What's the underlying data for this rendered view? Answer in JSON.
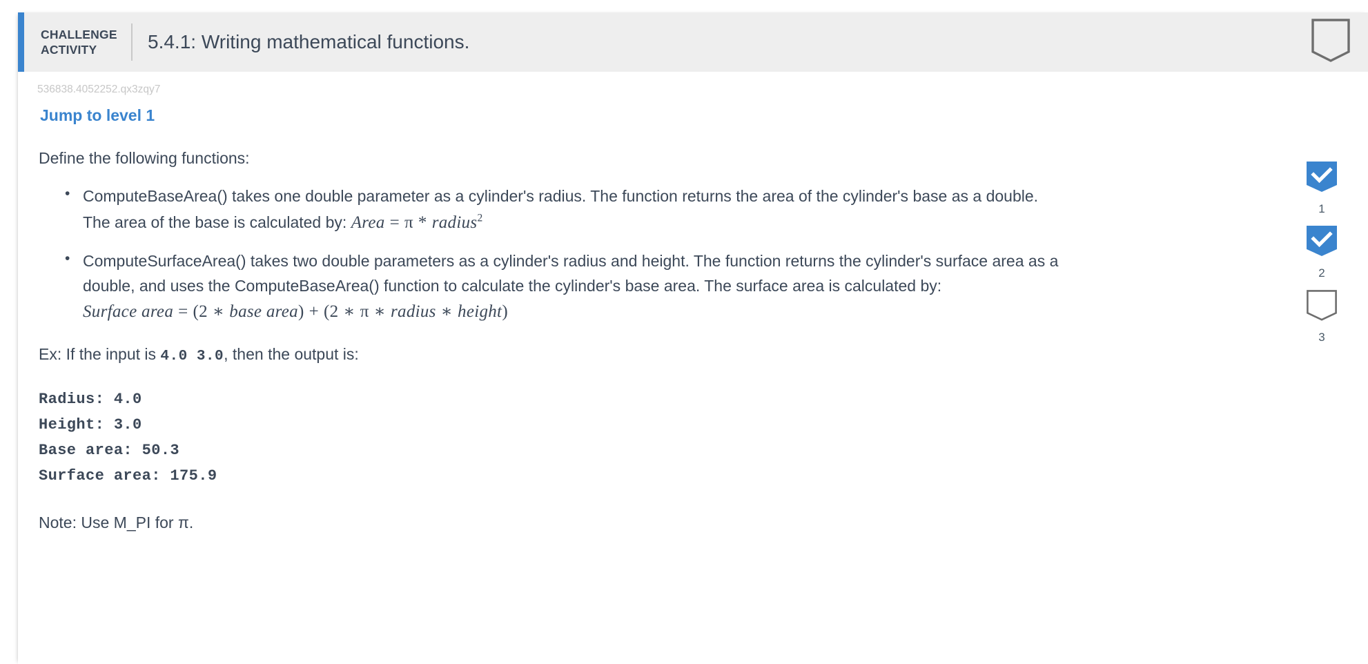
{
  "header": {
    "kicker_line1": "CHALLENGE",
    "kicker_line2": "ACTIVITY",
    "title": "5.4.1: Writing mathematical functions.",
    "banner_icon": "banner-outline-icon",
    "accent_color": "#3a84ce",
    "background_color": "#eeeeee"
  },
  "body": {
    "activity_id": "536838.4052252.qx3zqy7",
    "jump_link": "Jump to level 1",
    "intro": "Define the following functions:",
    "bullets": [
      {
        "text": "ComputeBaseArea() takes one double parameter as a cylinder's radius. The function returns the area of the cylinder's base as a double. The area of the base is calculated by: ",
        "formula": {
          "lhs": "Area",
          "eq": "=",
          "rhs_tokens": [
            "π",
            "*",
            "radius"
          ],
          "exponent": "2",
          "plain": "Area = π * radius^2"
        }
      },
      {
        "text": "ComputeSurfaceArea() takes two double parameters as a cylinder's radius and height. The function returns the cylinder's surface area as a double, and uses the ComputeBaseArea() function to calculate the cylinder's base area. The surface area is calculated by: ",
        "formula": {
          "lhs": "Surface area",
          "eq": "=",
          "plain": "Surface area = (2 * base area) + (2 * π * radius * height)"
        }
      }
    ],
    "example_prefix": "Ex: If the input is ",
    "example_input": "4.0  3.0",
    "example_suffix": ", then the output is:",
    "output_lines": [
      "Radius: 4.0",
      "Height: 3.0",
      "Base area: 50.3",
      "Surface area: 175.9"
    ],
    "note": "Note: Use M_PI for π."
  },
  "steps": [
    {
      "label": "1",
      "state": "complete",
      "icon": "banner-check-icon"
    },
    {
      "label": "2",
      "state": "complete",
      "icon": "banner-check-icon"
    },
    {
      "label": "3",
      "state": "incomplete",
      "icon": "banner-outline-icon"
    }
  ],
  "colors": {
    "accent": "#3a84ce",
    "text": "#3c4858",
    "muted": "#c7c7c7",
    "header_bg": "#eeeeee",
    "outline": "#6e6e6e"
  }
}
